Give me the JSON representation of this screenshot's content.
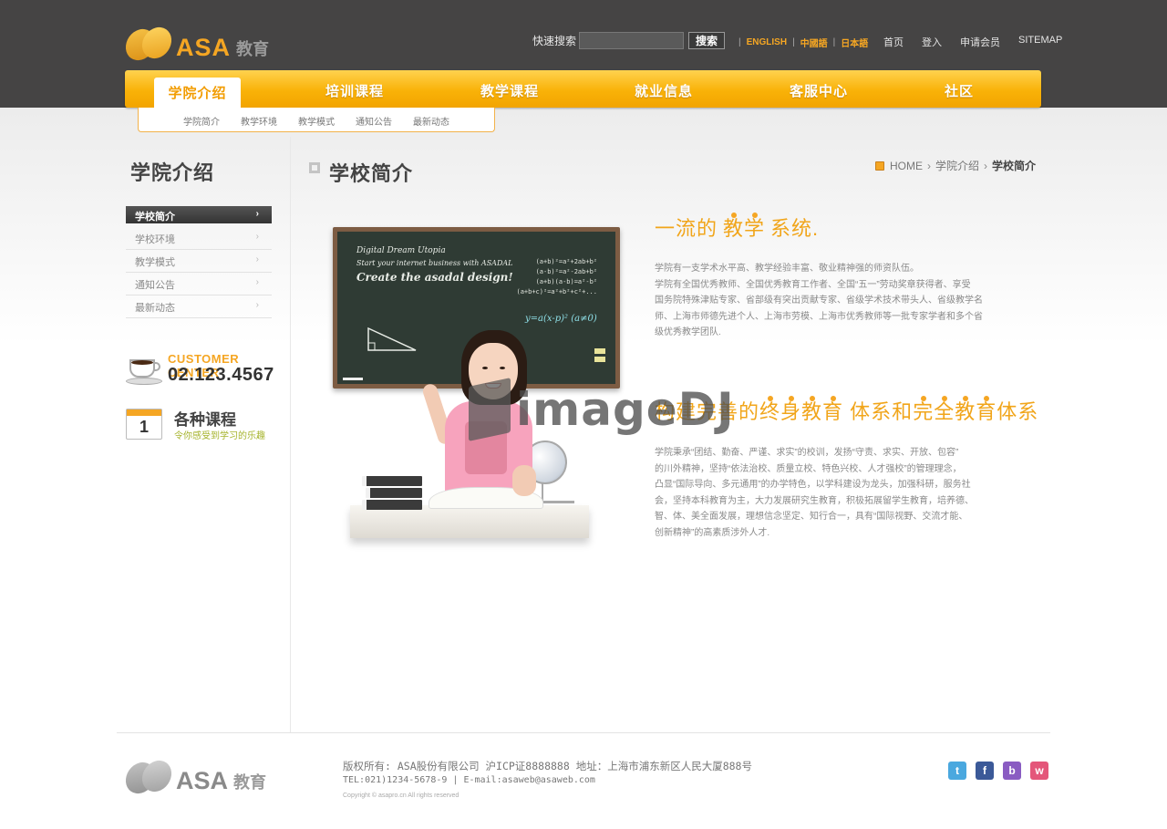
{
  "header": {
    "logo": {
      "brand": "ASA",
      "cn": "教育"
    },
    "search": {
      "label": "快速搜索",
      "placeholder": "",
      "value": "",
      "button": "搜索"
    },
    "languages": [
      "ENGLISH",
      "中國語",
      "日本語"
    ],
    "links": [
      "首页",
      "登入",
      "申请会员",
      "SITEMAP"
    ]
  },
  "nav": {
    "items": [
      "学院介绍",
      "培训课程",
      "教学课程",
      "就业信息",
      "客服中心",
      "社区"
    ],
    "active_index": 0,
    "sub_items": [
      "学院简介",
      "教学环境",
      "教学模式",
      "通知公告",
      "最新动态"
    ]
  },
  "sidebar": {
    "title": "学院介绍",
    "items": [
      {
        "label": "学校简介",
        "active": true
      },
      {
        "label": "学校环境",
        "active": false
      },
      {
        "label": "教学模式",
        "active": false
      },
      {
        "label": "通知公告",
        "active": false
      },
      {
        "label": "最新动态",
        "active": false
      }
    ],
    "customer": {
      "label": "CUSTOMER CENTER",
      "phone": "02.123.4567"
    },
    "course": {
      "title": "各种课程",
      "subtitle": "令你感受到学习的乐趣",
      "calendar_number": "1"
    }
  },
  "main": {
    "title": "学校简介",
    "breadcrumb": [
      "HOME",
      "学院介绍",
      "学校简介"
    ],
    "chalkboard": {
      "line1": "Digital Dream Utopia",
      "line2": "Start your internet business with ASADAL",
      "line3": "Create the asadal design!",
      "equations": [
        "(a+b)²=a²+2ab+b²",
        "(a-b)²=a²-2ab+b²",
        "(a+b)(a-b)=a²-b²",
        "(a+b+c)²=a²+b²+c²+...",
        "y=a(x-p)²  (a≠0)"
      ]
    },
    "watermark": "imageDJ",
    "section1": {
      "heading_pre": "一流的",
      "heading_emph": "教学",
      "heading_post": "系统.",
      "lines": [
        "学院有一支学术水平高、教学经验丰富、敬业精神强的师资队伍。",
        "学院有全国优秀教师、全国优秀教育工作者、全国“五一”劳动奖章获得者、享受",
        "国务院特殊津贴专家、省部级有突出贡献专家、省级学术技术带头人、省级教学名",
        "师、上海市师德先进个人、上海市劳模、上海市优秀教师等一批专家学者和多个省",
        "级优秀教学团队."
      ]
    },
    "section2": {
      "heading_a": "构建",
      "heading_b": "完善的",
      "heading_c": "终身教育",
      "heading_d": "体系和",
      "heading_e": "完全教育",
      "heading_f": "体系",
      "lines": [
        "学院秉承“团结、勤奋、严谨、求实”的校训，发扬“守责、求实、开放、包容”",
        "的川外精神，坚持“依法治校、质量立校、特色兴校、人才强校”的管理理念，",
        "凸显“国际导向、多元通用”的办学特色，以学科建设为龙头，加强科研，服务社",
        "会，坚持本科教育为主，大力发展研究生教育，积极拓展留学生教育，培养德、",
        "智、体、美全面发展，理想信念坚定、知行合一，具有“国际视野、交流才能、",
        "创新精神”的高素质涉外人才."
      ]
    }
  },
  "footer": {
    "logo": {
      "brand": "ASA",
      "cn": "教育"
    },
    "line1": "版权所有: ASA股份有限公司 沪ICP证8888888 地址：上海市浦东新区人民大厦888号",
    "line2": "TEL:021)1234-5678-9 | E-mail:asaweb@asaweb.com",
    "line3": "Copyright © asapro.cn All rights reserved",
    "social": [
      {
        "name": "twitter",
        "glyph": "t",
        "color": "#4aa8df"
      },
      {
        "name": "facebook",
        "glyph": "f",
        "color": "#3b5998"
      },
      {
        "name": "blog",
        "glyph": "b",
        "color": "#8a5cc2"
      },
      {
        "name": "weibo",
        "glyph": "w",
        "color": "#e4567a"
      }
    ]
  }
}
